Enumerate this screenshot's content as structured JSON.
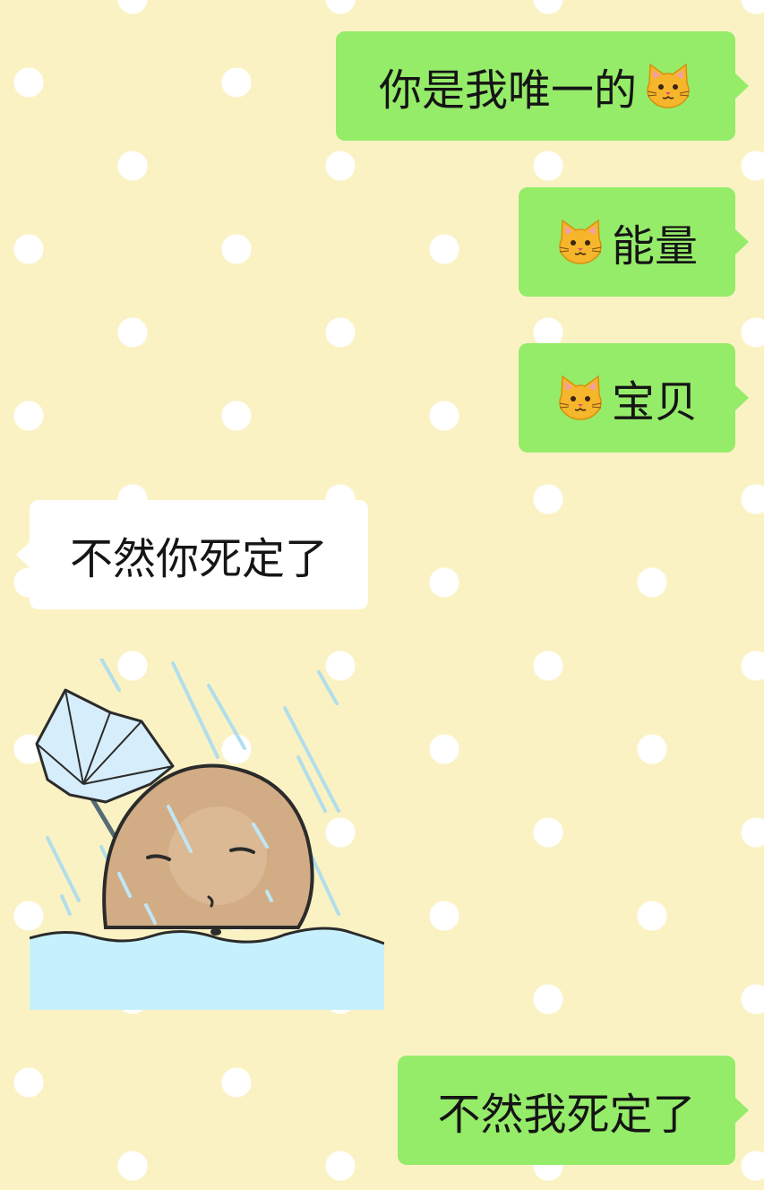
{
  "conversation": {
    "messages": [
      {
        "direction": "outgoing",
        "type": "text",
        "text": "你是我唯一的",
        "emoji_after": "cat-face-icon"
      },
      {
        "direction": "outgoing",
        "type": "text",
        "text": "能量",
        "emoji_before": "cat-face-icon"
      },
      {
        "direction": "outgoing",
        "type": "text",
        "text": "宝贝",
        "emoji_before": "cat-face-icon"
      },
      {
        "direction": "incoming",
        "type": "text",
        "text": "不然你死定了"
      },
      {
        "direction": "incoming",
        "type": "sticker",
        "sticker": "potato-in-rain-with-umbrella"
      },
      {
        "direction": "outgoing",
        "type": "text",
        "text": "不然我死定了"
      }
    ]
  },
  "theme": {
    "background": "#fbf2c4",
    "dots": "#ffffff",
    "outgoing_bubble": "#95ec69",
    "incoming_bubble": "#ffffff"
  }
}
